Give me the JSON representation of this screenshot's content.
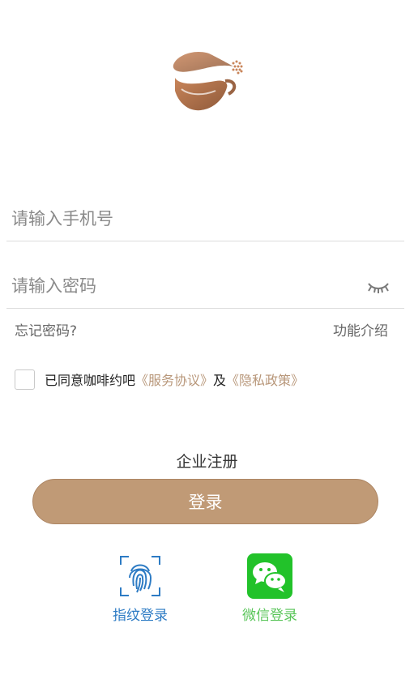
{
  "form": {
    "phone_placeholder": "请输入手机号",
    "password_placeholder": "请输入密码"
  },
  "links": {
    "forgot_password": "忘记密码?",
    "feature_intro": "功能介绍"
  },
  "agreement": {
    "checked": false,
    "prefix": "已同意咖啡约吧",
    "service_terms": "《服务协议》",
    "and": "及",
    "privacy_policy": "《隐私政策》"
  },
  "actions": {
    "register": "企业注册",
    "login": "登录",
    "fingerprint_login": "指纹登录",
    "wechat_login": "微信登录"
  },
  "icons": {
    "logo": "coffee-cup-logo-icon",
    "password_toggle": "eye-closed-icon",
    "fingerprint": "fingerprint-icon",
    "wechat": "wechat-icon"
  },
  "colors": {
    "accent": "#c09a76",
    "term_link": "#b8977a",
    "fingerprint_blue": "#2d7bc4",
    "wechat_green": "#59c559"
  }
}
